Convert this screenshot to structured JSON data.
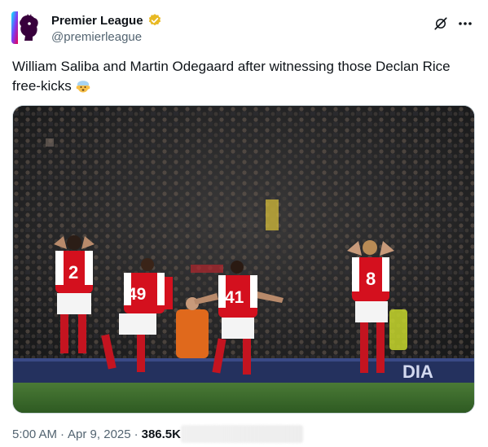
{
  "post": {
    "author": {
      "display_name": "Premier League",
      "handle": "@premierleague",
      "verified_badge_color": "#e8b923",
      "avatar_icon": "premier-league-lion-logo"
    },
    "header_icons": [
      "grok-icon",
      "more-options-icon"
    ],
    "text": "William Saliba and Martin Odegaard after witnessing those Declan Rice free-kicks",
    "emoji": "mind-blown-emoji",
    "image": {
      "description_icon": "football-celebration-photo",
      "player_numbers": [
        "2",
        "49",
        "41",
        "8"
      ],
      "board_text": "DIA"
    },
    "meta": {
      "time": "5:00 AM",
      "separator": "·",
      "date": "Apr 9, 2025",
      "views": "386.5K"
    }
  },
  "colors": {
    "text_primary": "#0f1419",
    "text_secondary": "#536471",
    "arsenal_red": "#d4101e",
    "pitch_green": "#3f6b2e"
  }
}
